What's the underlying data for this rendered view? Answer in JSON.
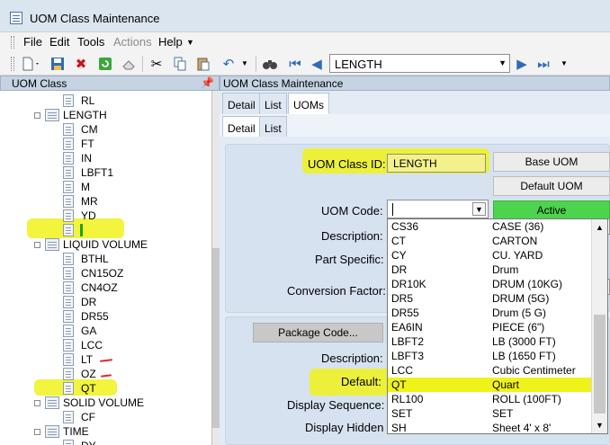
{
  "window": {
    "title": "UOM Class Maintenance"
  },
  "menu": {
    "items": [
      "File",
      "Edit",
      "Tools",
      "Actions",
      "Help"
    ]
  },
  "toolbar": {
    "class_selector_value": "LENGTH",
    "icons": [
      "new-document-icon",
      "save-icon",
      "delete-icon",
      "refresh-icon",
      "eraser-icon",
      "cut-icon",
      "copy-icon",
      "paste-icon",
      "undo-icon",
      "binoculars-icon",
      "first-record-icon",
      "previous-record-icon",
      "next-record-icon",
      "last-record-icon"
    ]
  },
  "left_panel": {
    "title": "UOM Class",
    "tree": [
      {
        "label": "RL",
        "type": "leaf"
      },
      {
        "label": "LENGTH",
        "type": "node"
      },
      {
        "label": "CM",
        "type": "leaf"
      },
      {
        "label": "FT",
        "type": "leaf"
      },
      {
        "label": "IN",
        "type": "leaf"
      },
      {
        "label": "LBFT1",
        "type": "leaf"
      },
      {
        "label": "M",
        "type": "leaf"
      },
      {
        "label": "MR",
        "type": "leaf"
      },
      {
        "label": "YD",
        "type": "leaf"
      },
      {
        "label": "",
        "type": "leaf"
      },
      {
        "label": "LIQUID VOLUME",
        "type": "node"
      },
      {
        "label": "BTHL",
        "type": "leaf"
      },
      {
        "label": "CN15OZ",
        "type": "leaf"
      },
      {
        "label": "CN4OZ",
        "type": "leaf"
      },
      {
        "label": "DR",
        "type": "leaf"
      },
      {
        "label": "DR55",
        "type": "leaf"
      },
      {
        "label": "GA",
        "type": "leaf"
      },
      {
        "label": "LCC",
        "type": "leaf"
      },
      {
        "label": "LT",
        "type": "leaf"
      },
      {
        "label": "OZ",
        "type": "leaf"
      },
      {
        "label": "QT",
        "type": "leaf"
      },
      {
        "label": "SOLID VOLUME",
        "type": "node"
      },
      {
        "label": "CF",
        "type": "leaf"
      },
      {
        "label": "TIME",
        "type": "node"
      },
      {
        "label": "DY",
        "type": "leaf"
      }
    ]
  },
  "right_panel": {
    "title": "UOM Class Maintenance",
    "tabs": [
      "Detail",
      "List",
      "UOMs"
    ],
    "subtabs": [
      "Detail",
      "List"
    ],
    "labels": {
      "class_id": "UOM Class ID:",
      "uom_code": "UOM Code:",
      "description": "Description:",
      "part_specific": "Part Specific:",
      "conversion_factor": "Conversion Factor:",
      "description2": "Description:",
      "default": "Default:",
      "display_sequence": "Display Sequence:",
      "display_hidden": "Display Hidden"
    },
    "class_id_value": "LENGTH",
    "uom_code_value": "",
    "buttons": {
      "base_uom": "Base UOM",
      "default_uom": "Default UOM",
      "active": "Active",
      "package_code": "Package Code..."
    }
  },
  "dropdown": {
    "rows": [
      {
        "code": "CS36",
        "desc": "CASE (36)"
      },
      {
        "code": "CT",
        "desc": "CARTON"
      },
      {
        "code": "CY",
        "desc": "CU. YARD"
      },
      {
        "code": "DR",
        "desc": "Drum"
      },
      {
        "code": "DR10K",
        "desc": "DRUM (10KG)"
      },
      {
        "code": "DR5",
        "desc": "DRUM (5G)"
      },
      {
        "code": "DR55",
        "desc": "Drum (5 G)"
      },
      {
        "code": "EA6IN",
        "desc": "PIECE (6\")"
      },
      {
        "code": "LBFT2",
        "desc": "LB (3000 FT)"
      },
      {
        "code": "LBFT3",
        "desc": "LB (1650 FT)"
      },
      {
        "code": "LCC",
        "desc": "Cubic Centimeter"
      },
      {
        "code": "QT",
        "desc": "Quart"
      },
      {
        "code": "RL100",
        "desc": "ROLL (100FT)"
      },
      {
        "code": "SET",
        "desc": "SET"
      },
      {
        "code": "SH",
        "desc": "Sheet 4' x 8'"
      }
    ]
  }
}
